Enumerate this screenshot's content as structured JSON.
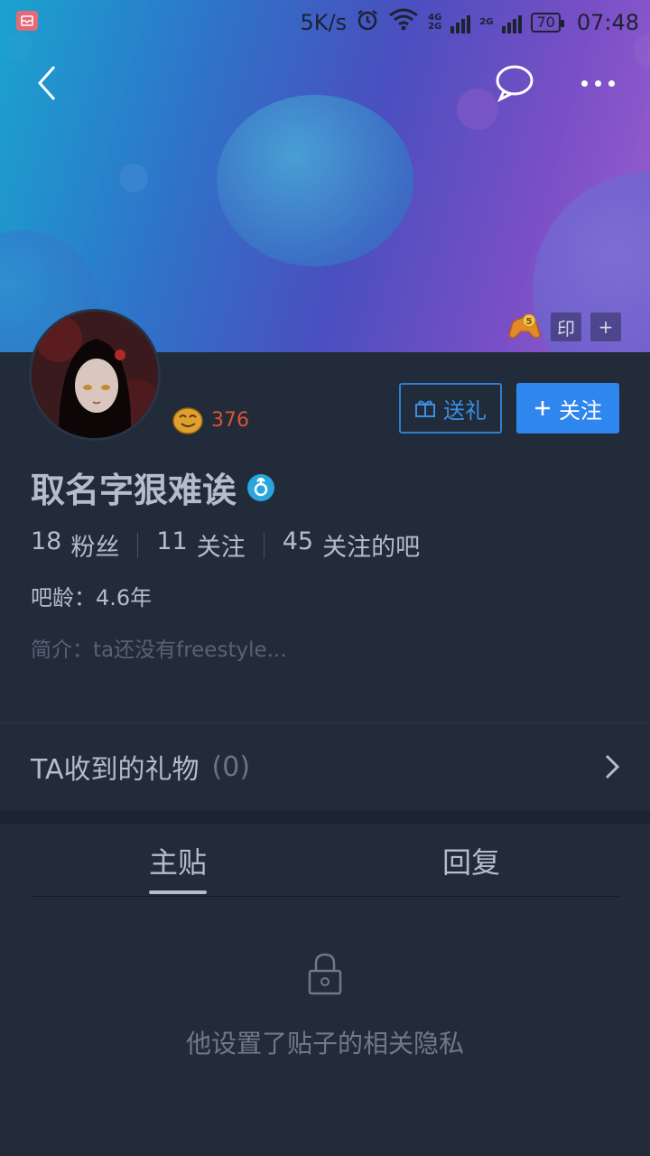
{
  "status_bar": {
    "speed": "5K/s",
    "net_a_top": "4G",
    "net_a_bottom": "2G",
    "net_b": "2G",
    "battery": "70",
    "time": "07:48"
  },
  "header": {
    "badge_box_1": "印",
    "badge_box_2": "+"
  },
  "profile": {
    "level": "376",
    "username": "取名字狠难诶",
    "gender": "male",
    "stats": [
      {
        "num": "18",
        "label": "粉丝"
      },
      {
        "num": "11",
        "label": "关注"
      },
      {
        "num": "45",
        "label": "关注的吧"
      }
    ],
    "age_label": "吧龄：",
    "age_value": "4.6年",
    "bio": "简介：ta还没有freestyle..."
  },
  "actions": {
    "gift_label": "送礼",
    "follow_label": "关注"
  },
  "gifts": {
    "title": "TA收到的礼物",
    "count": "(0)"
  },
  "tabs": [
    {
      "label": "主贴",
      "active": true
    },
    {
      "label": "回复",
      "active": false
    }
  ],
  "empty_state": {
    "message": "他设置了贴子的相关隐私"
  },
  "colors": {
    "accent": "#2f86ee",
    "background": "#222b39",
    "level": "#d9542f"
  }
}
